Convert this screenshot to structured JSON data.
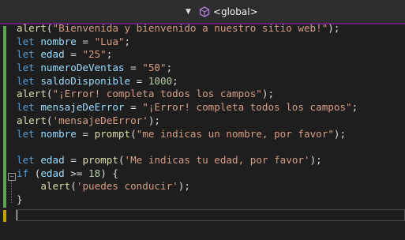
{
  "toolbar": {
    "scope_label": "<global>"
  },
  "colors": {
    "editor_bg": "#1e1e1e",
    "keyword": "#569cd6",
    "string": "#d69d85",
    "number": "#b5cea8",
    "variable": "#9cdcfe",
    "function": "#dcdcaa",
    "change_green": "#57a64a",
    "change_yellow": "#c9a100",
    "accent_purple": "#68217a"
  },
  "code": {
    "lines": [
      [
        [
          "fn",
          "alert"
        ],
        [
          "plain",
          "("
        ],
        [
          "str",
          "\"Bienvenida y bienvenido a nuestro sitio web!\""
        ],
        [
          "plain",
          ");"
        ]
      ],
      [
        [
          "kw",
          "let"
        ],
        [
          "plain",
          " "
        ],
        [
          "var",
          "nombre"
        ],
        [
          "plain",
          " = "
        ],
        [
          "str",
          "\"Lua\""
        ],
        [
          "plain",
          ";"
        ]
      ],
      [
        [
          "kw",
          "let"
        ],
        [
          "plain",
          " "
        ],
        [
          "var",
          "edad"
        ],
        [
          "plain",
          " = "
        ],
        [
          "str",
          "\"25\""
        ],
        [
          "plain",
          ";"
        ]
      ],
      [
        [
          "kw",
          "let"
        ],
        [
          "plain",
          " "
        ],
        [
          "var",
          "numeroDeVentas"
        ],
        [
          "plain",
          " = "
        ],
        [
          "str",
          "\"50\""
        ],
        [
          "plain",
          ";"
        ]
      ],
      [
        [
          "kw",
          "let"
        ],
        [
          "plain",
          " "
        ],
        [
          "var",
          "saldoDisponible"
        ],
        [
          "plain",
          " = "
        ],
        [
          "num",
          "1000"
        ],
        [
          "plain",
          ";"
        ]
      ],
      [
        [
          "fn",
          "alert"
        ],
        [
          "plain",
          "("
        ],
        [
          "str",
          "\"¡Error! completa todos los campos\""
        ],
        [
          "plain",
          ");"
        ]
      ],
      [
        [
          "kw",
          "let"
        ],
        [
          "plain",
          " "
        ],
        [
          "var",
          "mensajeDeError"
        ],
        [
          "plain",
          " = "
        ],
        [
          "str",
          "\"¡Error! completa todos los campos\""
        ],
        [
          "plain",
          ";"
        ]
      ],
      [
        [
          "fn",
          "alert"
        ],
        [
          "plain",
          "("
        ],
        [
          "str",
          "'mensajeDeError'"
        ],
        [
          "plain",
          ");"
        ]
      ],
      [
        [
          "kw",
          "let"
        ],
        [
          "plain",
          " "
        ],
        [
          "var",
          "nombre"
        ],
        [
          "plain",
          " = "
        ],
        [
          "fn",
          "prompt"
        ],
        [
          "plain",
          "("
        ],
        [
          "str",
          "\"me indicas un nombre, por favor\""
        ],
        [
          "plain",
          ");"
        ]
      ],
      [
        [
          "plain",
          ""
        ]
      ],
      [
        [
          "kw",
          "let"
        ],
        [
          "plain",
          " "
        ],
        [
          "var",
          "edad"
        ],
        [
          "plain",
          " = "
        ],
        [
          "fn",
          "prompt"
        ],
        [
          "plain",
          "("
        ],
        [
          "str",
          "'Me indicas tu edad, por favor'"
        ],
        [
          "plain",
          ");"
        ]
      ],
      [
        [
          "kw",
          "if"
        ],
        [
          "plain",
          " ("
        ],
        [
          "var",
          "edad"
        ],
        [
          "plain",
          " >= "
        ],
        [
          "num",
          "18"
        ],
        [
          "plain",
          ") {"
        ]
      ],
      [
        [
          "plain",
          "    "
        ],
        [
          "fn",
          "alert"
        ],
        [
          "plain",
          "("
        ],
        [
          "str",
          "'puedes conducir'"
        ],
        [
          "plain",
          ");"
        ]
      ],
      [
        [
          "plain",
          "}"
        ]
      ]
    ]
  }
}
